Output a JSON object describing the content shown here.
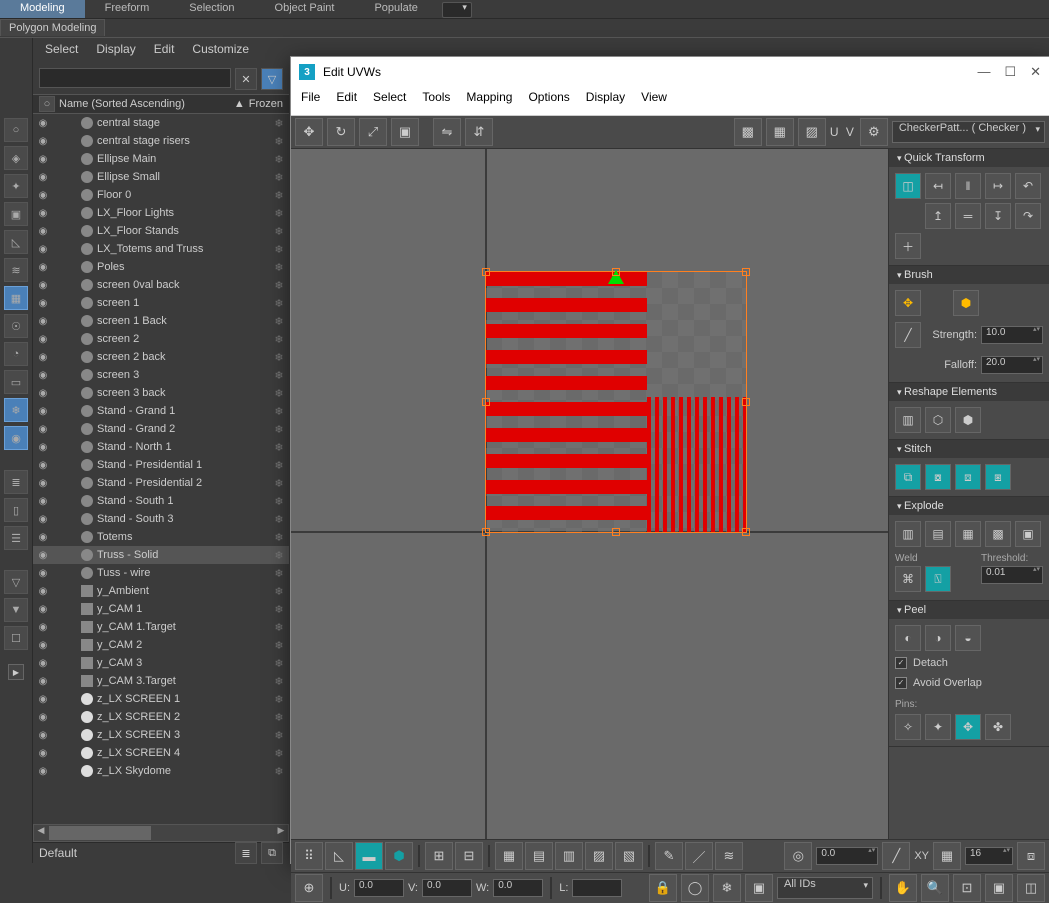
{
  "topTabs": {
    "items": [
      "Modeling",
      "Freeform",
      "Selection",
      "Object Paint",
      "Populate"
    ],
    "active": 0
  },
  "ribbon": {
    "tab": "Polygon Modeling"
  },
  "sceneMenu": [
    "Select",
    "Display",
    "Edit",
    "Customize"
  ],
  "sceneHeader": {
    "name": "Name (Sorted Ascending)",
    "frozen": "Frozen",
    "arrow": "▲"
  },
  "sceneItems": [
    {
      "name": "central stage",
      "type": "geo"
    },
    {
      "name": "central stage risers",
      "type": "geo"
    },
    {
      "name": "Ellipse Main",
      "type": "geo"
    },
    {
      "name": "Ellipse Small",
      "type": "geo"
    },
    {
      "name": "Floor 0",
      "type": "geo"
    },
    {
      "name": "LX_Floor Lights",
      "type": "geo"
    },
    {
      "name": "LX_Floor Stands",
      "type": "geo"
    },
    {
      "name": "LX_Totems and Truss",
      "type": "geo"
    },
    {
      "name": "Poles",
      "type": "geo"
    },
    {
      "name": "screen 0val back",
      "type": "geo"
    },
    {
      "name": "screen 1",
      "type": "geo"
    },
    {
      "name": "screen 1 Back",
      "type": "geo"
    },
    {
      "name": "screen 2",
      "type": "geo"
    },
    {
      "name": "screen 2 back",
      "type": "geo"
    },
    {
      "name": "screen 3",
      "type": "geo"
    },
    {
      "name": "screen 3 back",
      "type": "geo"
    },
    {
      "name": "Stand - Grand 1",
      "type": "geo"
    },
    {
      "name": "Stand - Grand 2",
      "type": "geo"
    },
    {
      "name": "Stand - North 1",
      "type": "geo"
    },
    {
      "name": "Stand - Presidential 1",
      "type": "geo"
    },
    {
      "name": "Stand - Presidential 2",
      "type": "geo"
    },
    {
      "name": "Stand - South 1",
      "type": "geo"
    },
    {
      "name": "Stand - South 3",
      "type": "geo"
    },
    {
      "name": "Totems",
      "type": "geo"
    },
    {
      "name": "Truss - Solid",
      "type": "geo",
      "selected": true
    },
    {
      "name": "Tuss - wire",
      "type": "geo"
    },
    {
      "name": "y_Ambient",
      "type": "cam"
    },
    {
      "name": "y_CAM 1",
      "type": "cam"
    },
    {
      "name": "y_CAM 1.Target",
      "type": "cam"
    },
    {
      "name": "y_CAM 2",
      "type": "cam"
    },
    {
      "name": "y_CAM 3",
      "type": "cam"
    },
    {
      "name": "y_CAM 3.Target",
      "type": "cam"
    },
    {
      "name": "z_LX SCREEN 1",
      "type": "light"
    },
    {
      "name": "z_LX SCREEN 2",
      "type": "light"
    },
    {
      "name": "z_LX SCREEN 3",
      "type": "light"
    },
    {
      "name": "z_LX SCREEN 4",
      "type": "light"
    },
    {
      "name": "z_LX Skydome",
      "type": "light"
    }
  ],
  "status": {
    "layer": "Default"
  },
  "uv": {
    "title": "Edit UVWs",
    "menu": [
      "File",
      "Edit",
      "Select",
      "Tools",
      "Mapping",
      "Options",
      "Display",
      "View"
    ],
    "uvLabel": "U V",
    "mapDrop": "CheckerPatt... ( Checker )",
    "rollouts": {
      "quickTransform": "Quick Transform",
      "brush": "Brush",
      "strength": "Strength:",
      "falloff": "Falloff:",
      "strengthVal": "10.0",
      "falloffVal": "20.0",
      "reshape": "Reshape Elements",
      "stitch": "Stitch",
      "explode": "Explode",
      "weld": "Weld",
      "threshold": "Threshold:",
      "thresholdVal": "0.01",
      "peel": "Peel",
      "detach": "Detach",
      "avoidOverlap": "Avoid Overlap",
      "pins": "Pins:"
    },
    "foot": {
      "spinVal": "0.0",
      "xy": "XY",
      "gridVal": "16",
      "u": "U:",
      "v": "V:",
      "w": "W:",
      "l": "L:",
      "uv": "0.0",
      "vv": "0.0",
      "wv": "0.0",
      "lv": "",
      "allIds": "All IDs"
    }
  }
}
